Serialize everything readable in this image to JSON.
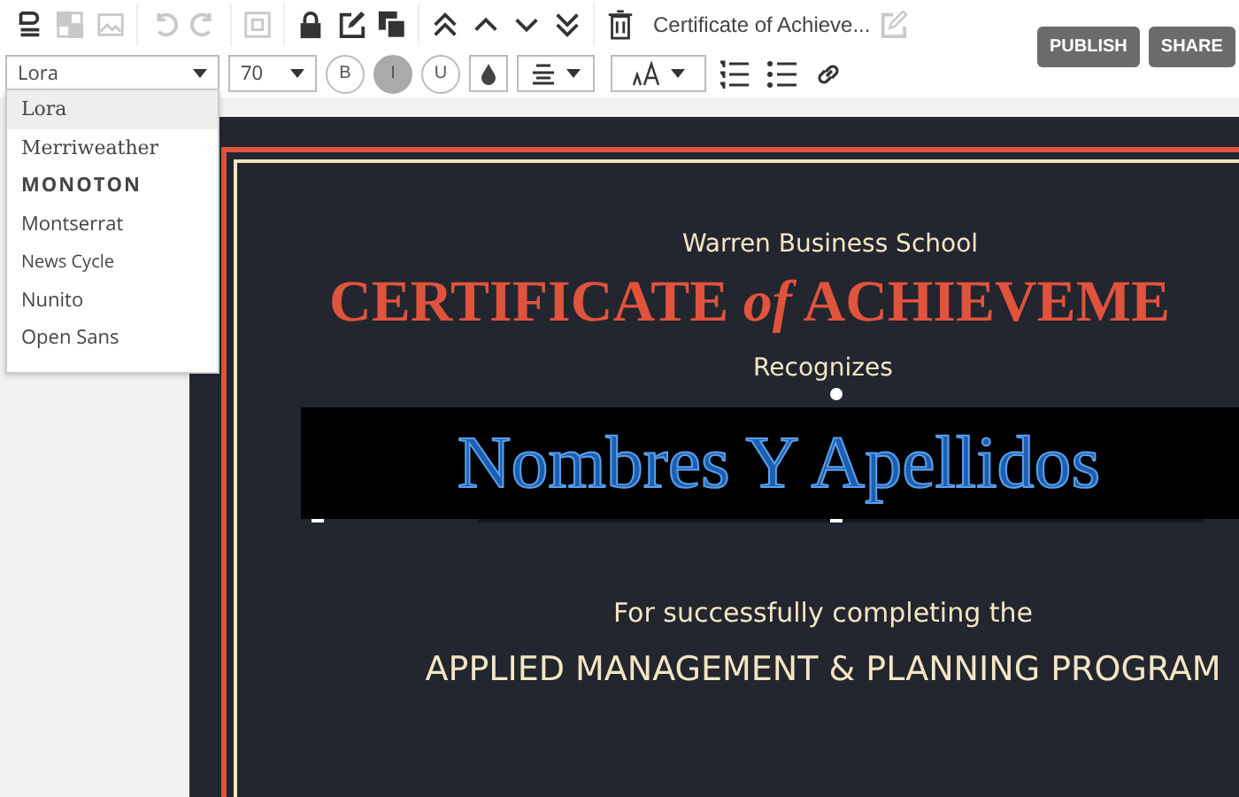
{
  "toolbar": {
    "tools": [
      {
        "kind": "baseline",
        "disabled": false
      },
      {
        "kind": "checker",
        "disabled": true
      },
      {
        "kind": "image",
        "disabled": true
      },
      {
        "kind": "undo",
        "disabled": true
      },
      {
        "kind": "redo",
        "disabled": true
      },
      {
        "kind": "frame",
        "disabled": true
      },
      {
        "kind": "lock",
        "disabled": false
      },
      {
        "kind": "edit",
        "disabled": false
      },
      {
        "kind": "layers",
        "disabled": false
      },
      {
        "kind": "top",
        "disabled": false
      },
      {
        "kind": "up",
        "disabled": false
      },
      {
        "kind": "down",
        "disabled": false
      },
      {
        "kind": "bottom",
        "disabled": false
      },
      {
        "kind": "trash",
        "disabled": false
      }
    ],
    "document_title": "Certificate of Achieve...",
    "rename_disabled": true,
    "buttons": [
      "PUBLISH",
      "SHARE"
    ]
  },
  "format_bar": {
    "font": "Lora",
    "size": "70",
    "styles": [
      {
        "label": "B",
        "selected": false
      },
      {
        "label": "I",
        "selected": true
      },
      {
        "label": "U",
        "selected": false
      }
    ]
  },
  "font_menu": [
    {
      "label": "Lora",
      "selected": true
    },
    {
      "label": "Merriweather",
      "selected": false
    },
    {
      "label": "MONOTON",
      "selected": false
    },
    {
      "label": "Montserrat",
      "selected": false
    },
    {
      "label": "News Cycle",
      "selected": false
    },
    {
      "label": "Nunito",
      "selected": false
    },
    {
      "label": "Open Sans",
      "selected": false
    }
  ],
  "certificate": {
    "school": "Warren Business School",
    "title": "CERTIFICATE *of* ACHIEVEME",
    "recognizes": "Recognizes",
    "name": "Nombres Y Apellidos",
    "name_selected": true,
    "completion": "For successfully completing the",
    "program": "APPLIED MANAGEMENT & PLANNING PROGRAM"
  }
}
